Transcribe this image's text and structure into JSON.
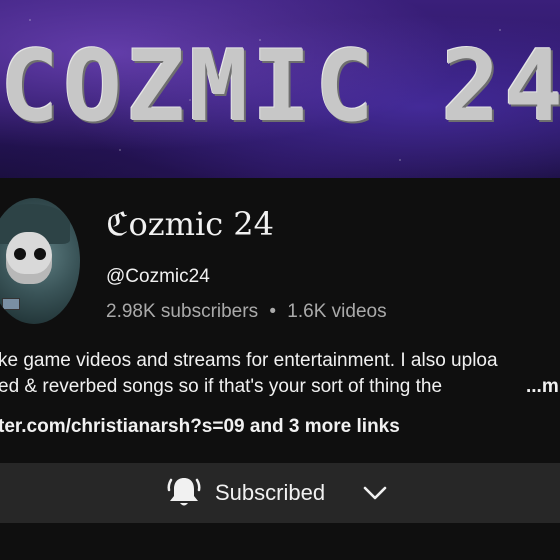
{
  "banner": {
    "title": "COZMIC 24"
  },
  "channel": {
    "name": "ℭozmic 24",
    "handle": "@Cozmic24",
    "subscribers": "2.98K subscribers",
    "separator": "•",
    "videos": "1.6K videos"
  },
  "description": {
    "line1": "ke game videos and streams for entertainment. I also uploa",
    "line2": "ed & reverbed songs so if that's your sort of thing the",
    "more_label": "...m"
  },
  "links": {
    "text": "ter.com/christianarsh?s=09 and 3 more links"
  },
  "subscribe": {
    "label": "Subscribed",
    "icon": "bell-icon",
    "chevron": "chevron-down-icon"
  },
  "colors": {
    "background": "#0f0f0f",
    "button_bg": "#272727",
    "muted_text": "#aaaaaa"
  }
}
